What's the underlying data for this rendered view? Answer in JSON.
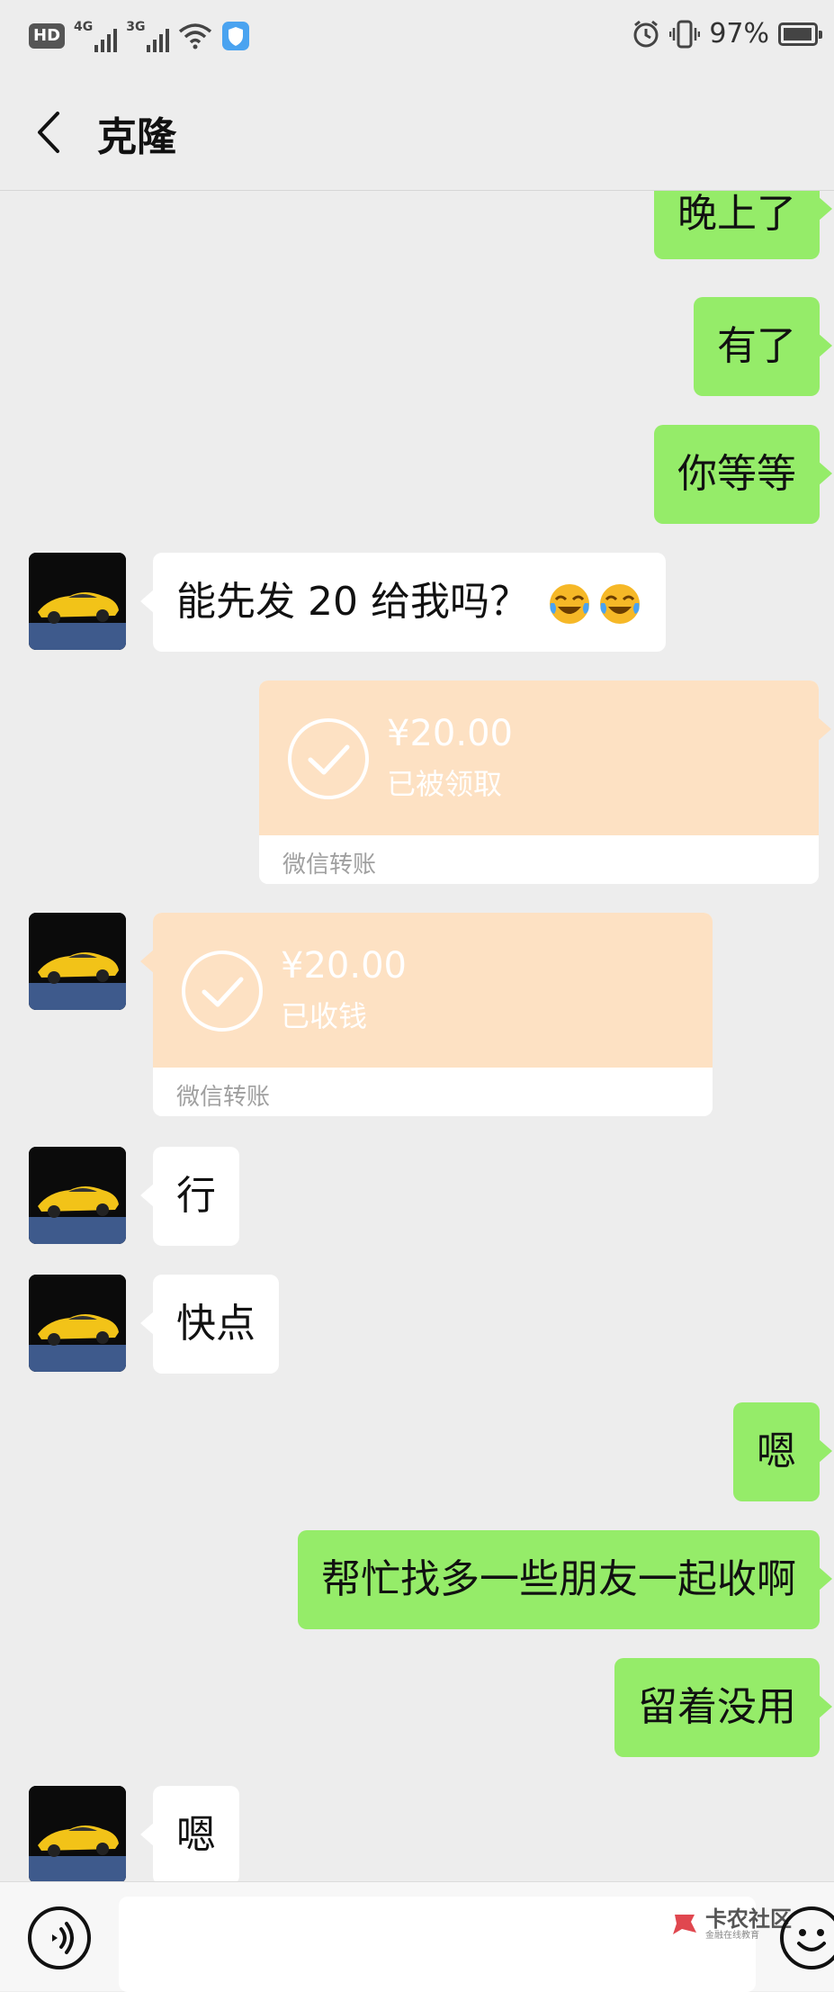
{
  "status_bar": {
    "hd": "HD",
    "network1": "4G",
    "network2": "3G",
    "battery_percent": "97%",
    "battery_level": 0.97
  },
  "nav": {
    "title": "克隆",
    "back_icon": "chevron-left-icon"
  },
  "messages": [
    {
      "side": "me",
      "text": "晚上了"
    },
    {
      "side": "me",
      "text": "有了"
    },
    {
      "side": "me",
      "text": "你等等"
    },
    {
      "side": "them",
      "text": "能先发 20 给我吗？",
      "emoji": [
        "crying-laughing-emoji",
        "crying-laughing-emoji"
      ]
    },
    {
      "side": "me",
      "type": "transfer",
      "amount": "¥20.00",
      "status": "已被领取",
      "label": "微信转账"
    },
    {
      "side": "them",
      "type": "transfer",
      "amount": "¥20.00",
      "status": "已收钱",
      "label": "微信转账"
    },
    {
      "side": "them",
      "text": "行"
    },
    {
      "side": "them",
      "text": "快点"
    },
    {
      "side": "me",
      "text": "嗯"
    },
    {
      "side": "me",
      "text": "帮忙找多一些朋友一起收啊"
    },
    {
      "side": "me",
      "text": "留着没用"
    },
    {
      "side": "them",
      "text": "嗯"
    }
  ],
  "input_bar": {
    "voice_icon": "voice-icon",
    "emoji_icon": "smiley-face-icon",
    "input_value": ""
  },
  "watermark": {
    "main": "卡农社区",
    "sub": "金融在线教育"
  },
  "colors": {
    "my_bubble": "#95ec69",
    "their_bubble": "#ffffff",
    "transfer_bg": "#fde1c3",
    "chat_bg": "#ededed"
  }
}
